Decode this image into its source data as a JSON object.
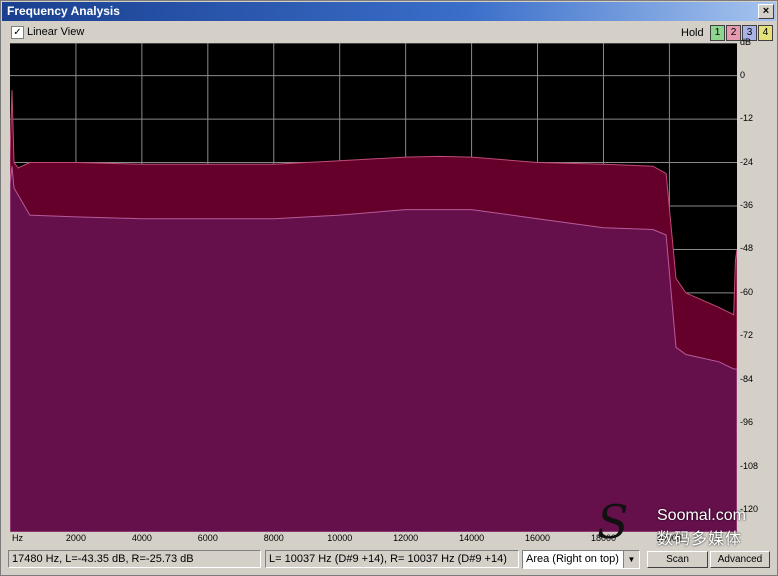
{
  "window": {
    "title": "Frequency Analysis",
    "close_glyph": "×"
  },
  "toolbar": {
    "linear_view_checked": true,
    "linear_view_label": "Linear View",
    "check_glyph": "✓",
    "hold_label": "Hold",
    "hold_buttons": [
      {
        "label": "1",
        "color": "#8fd48f"
      },
      {
        "label": "2",
        "color": "#e69ab0"
      },
      {
        "label": "3",
        "color": "#a9b3e8"
      },
      {
        "label": "4",
        "color": "#e6e07a"
      }
    ]
  },
  "chart_data": {
    "type": "area",
    "x_unit": "Hz",
    "y_unit": "dB",
    "xlim": [
      0,
      22050
    ],
    "ylim": [
      -126,
      9
    ],
    "x_ticks": [
      "Hz",
      "2000",
      "4000",
      "6000",
      "8000",
      "10000",
      "12000",
      "14000",
      "16000",
      "18000",
      "20000"
    ],
    "x_tick_values": [
      0,
      2000,
      4000,
      6000,
      8000,
      10000,
      12000,
      14000,
      16000,
      18000,
      20000
    ],
    "y_ticks": [
      "dB",
      "0",
      "-12",
      "-24",
      "-36",
      "-48",
      "-60",
      "-72",
      "-84",
      "-96",
      "-108",
      "-120"
    ],
    "y_tick_values": [
      9,
      0,
      -12,
      -24,
      -36,
      -48,
      -60,
      -72,
      -84,
      -96,
      -108,
      -120
    ],
    "grid": true,
    "background": "#000000",
    "series": [
      {
        "fill": "#64002a",
        "line": "#c04a76",
        "x": [
          0,
          60,
          120,
          250,
          600,
          2000,
          4000,
          6000,
          8000,
          10000,
          12000,
          13000,
          14000,
          16000,
          18000,
          19500,
          19900,
          20200,
          20500,
          21000,
          21500,
          21950,
          22000,
          22050
        ],
        "y": [
          -22,
          -4,
          -24,
          -25.5,
          -24,
          -24,
          -24.5,
          -24.5,
          -24.5,
          -23.5,
          -22.5,
          -22.3,
          -22.5,
          -24,
          -24.5,
          -25,
          -27,
          -56,
          -60,
          -62,
          -64,
          -66,
          -51,
          -48
        ]
      },
      {
        "fill": "#65104b",
        "line": "#b85a9a",
        "x": [
          0,
          60,
          120,
          600,
          2000,
          4000,
          6000,
          8000,
          10000,
          12000,
          13000,
          14000,
          16000,
          18000,
          19500,
          19900,
          20200,
          20500,
          21000,
          21500,
          21950,
          22050
        ],
        "y": [
          -30,
          -25,
          -31,
          -38.5,
          -39,
          -39.5,
          -39.5,
          -39.5,
          -38.5,
          -37,
          -37,
          -37,
          -39.5,
          -42,
          -42.5,
          -44,
          -75,
          -77,
          -78,
          -79,
          -81,
          -81
        ]
      }
    ]
  },
  "status": {
    "cursor_readout": "17480 Hz, L=-43.35 dB, R=-25.73 dB",
    "peak_readout": "L=  10037 Hz (D#9 +14), R=  10037 Hz (D#9 +14)",
    "mode_select": "Area (Right on top)",
    "scan_label": "Scan",
    "advanced_label": "Advanced",
    "arrow_glyph": "▼"
  },
  "watermark": {
    "logo_glyph": "S",
    "line1": "Soomal.com",
    "line2": "数码多媒体"
  }
}
